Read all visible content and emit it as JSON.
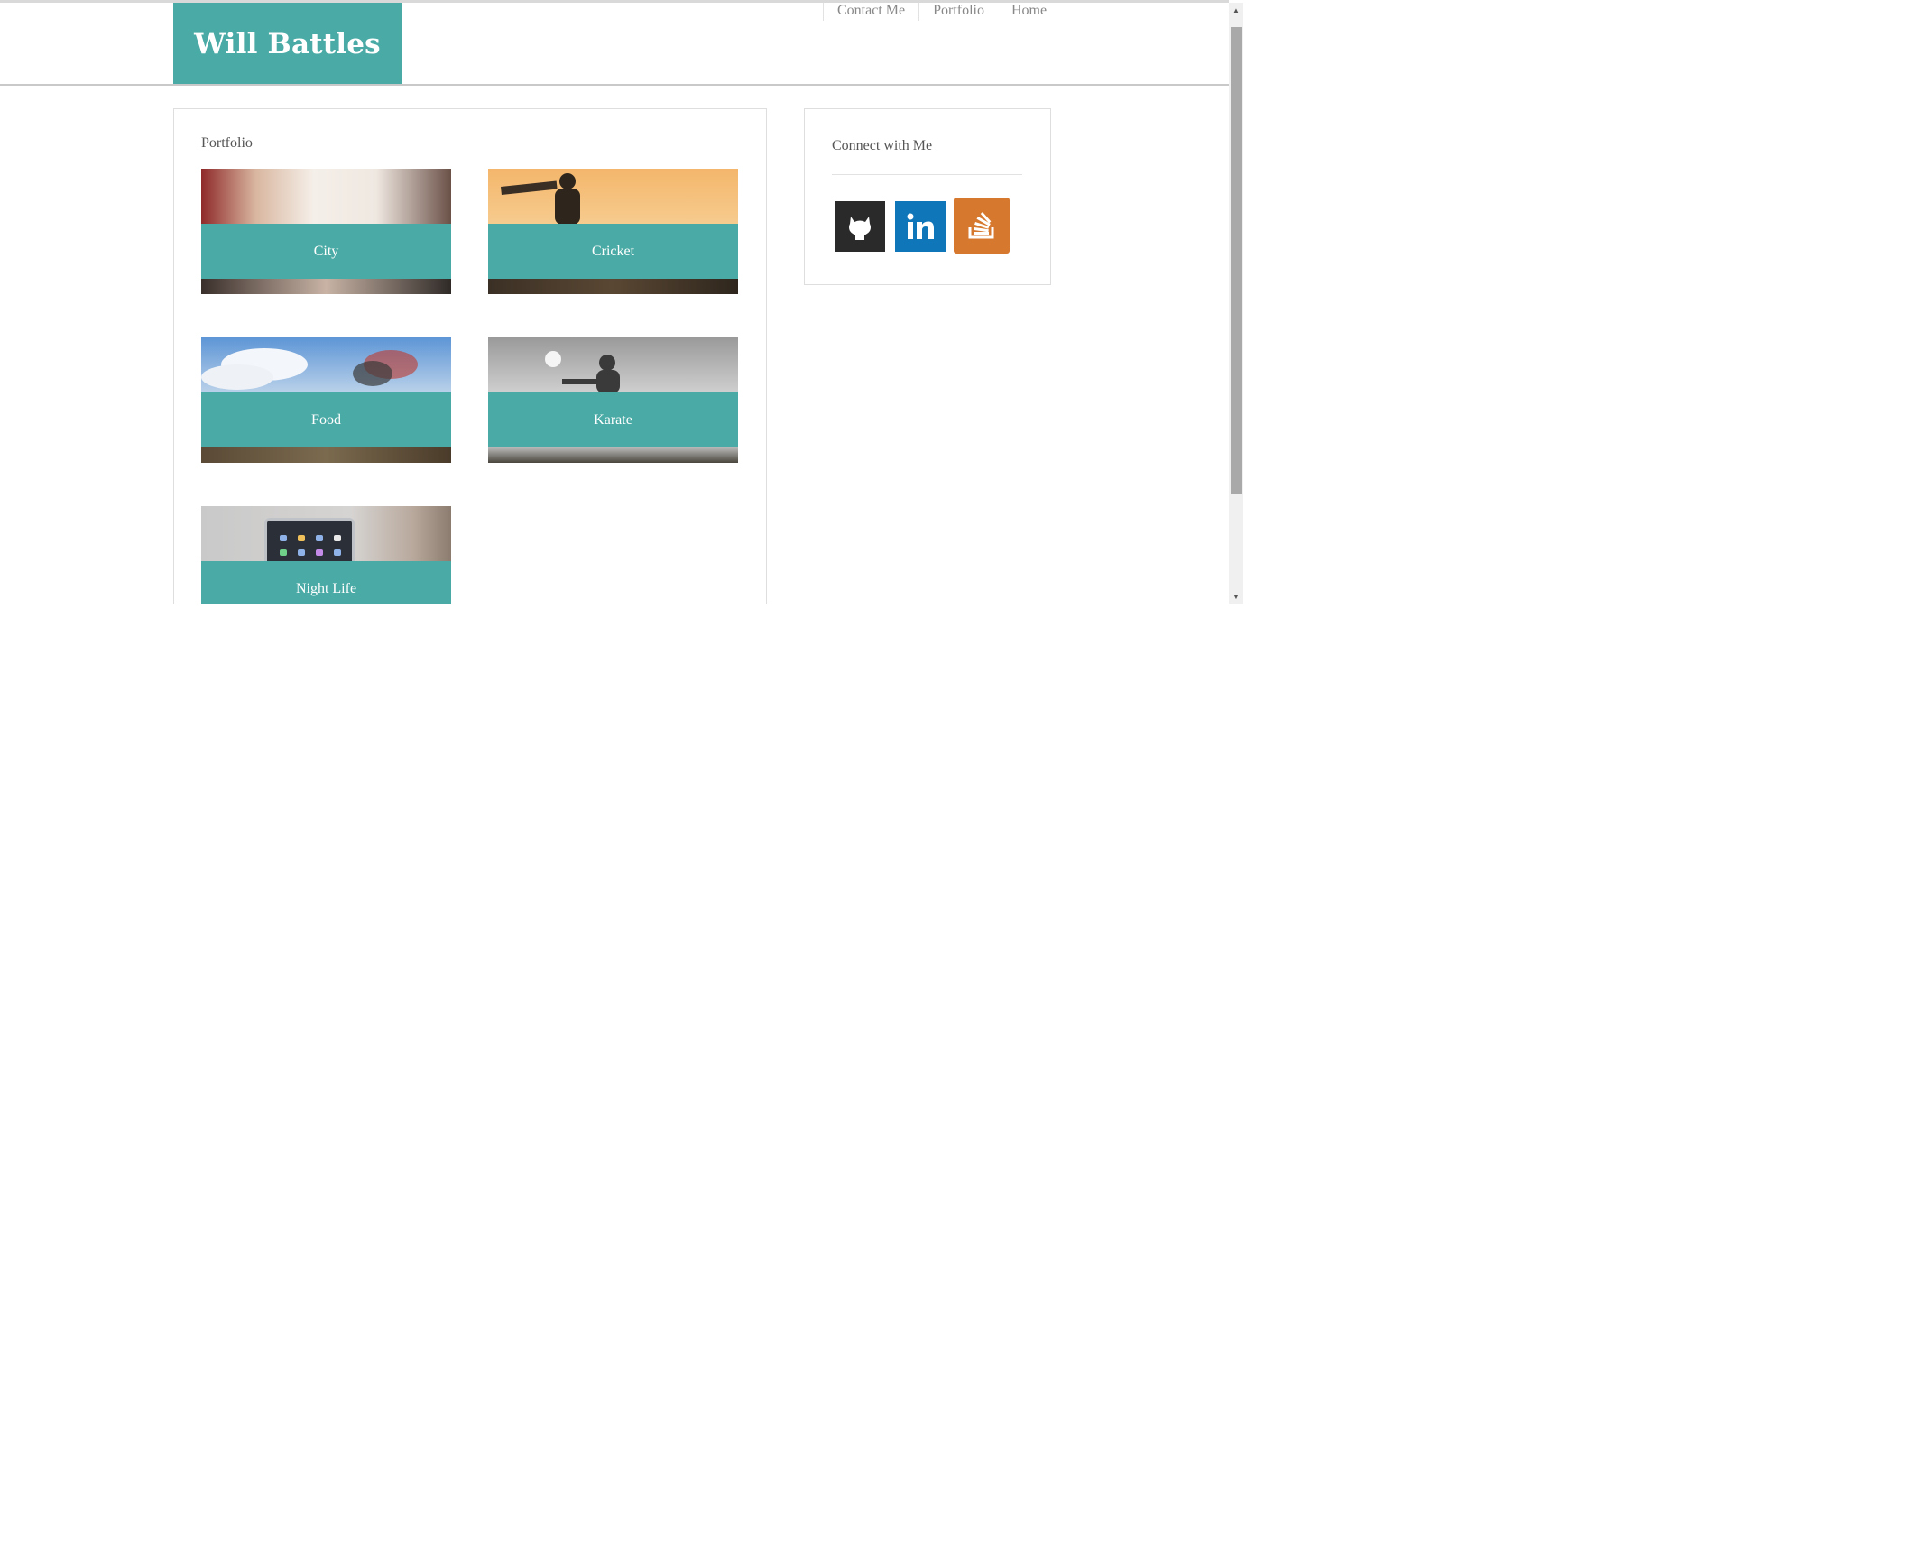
{
  "site": {
    "brand": "Will Battles",
    "brand_color": "#4aaaa5"
  },
  "nav": {
    "items": [
      {
        "label": "Contact Me"
      },
      {
        "label": "Portfolio"
      },
      {
        "label": "Home"
      }
    ]
  },
  "portfolio": {
    "title": "Portfolio",
    "items": [
      {
        "label": "City",
        "image": "city-photo"
      },
      {
        "label": "Cricket",
        "image": "cricket-photo"
      },
      {
        "label": "Food",
        "image": "food-photo"
      },
      {
        "label": "Karate",
        "image": "karate-photo"
      },
      {
        "label": "Night Life",
        "image": "night-life-photo"
      }
    ]
  },
  "sidebar": {
    "title": "Connect with Me",
    "social": [
      {
        "name": "github-icon",
        "color": "#2a2a2a"
      },
      {
        "name": "linkedin-icon",
        "color": "#0e76b9"
      },
      {
        "name": "stackoverflow-icon",
        "color": "#d7782f"
      }
    ]
  }
}
